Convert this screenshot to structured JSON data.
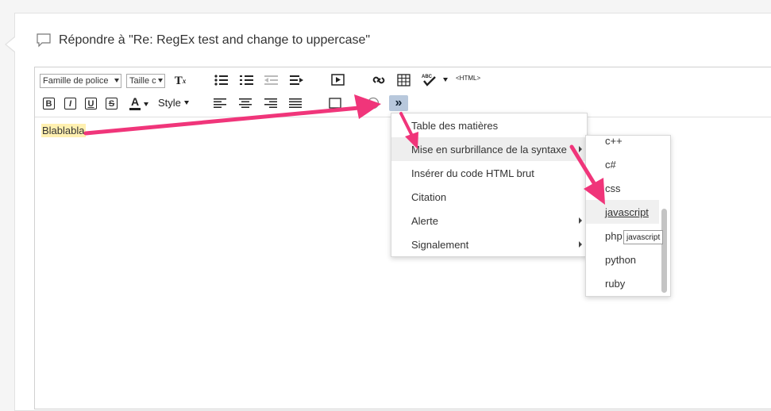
{
  "reply": {
    "title": "Répondre à \"Re: RegEx test and change to uppercase\""
  },
  "toolbar": {
    "font_family": "Famille de police",
    "font_size": "Taille c",
    "clear_format": "T",
    "clear_format_sub": "x",
    "html_label": "<HTML>",
    "spell_label": "ABC",
    "bold": "B",
    "italic": "I",
    "underline": "U",
    "strike": "S",
    "text_color": "A",
    "style_label": "Style",
    "more_label": "»"
  },
  "editor": {
    "content": "Blablabla"
  },
  "menu": {
    "items": [
      {
        "label": "Table des matières",
        "submenu": false
      },
      {
        "label": "Mise en surbrillance de la syntaxe",
        "submenu": true
      },
      {
        "label": "Insérer du code HTML brut",
        "submenu": false
      },
      {
        "label": "Citation",
        "submenu": false
      },
      {
        "label": "Alerte",
        "submenu": true
      },
      {
        "label": "Signalement",
        "submenu": true
      }
    ]
  },
  "submenu": {
    "items": [
      "c++",
      "c#",
      "css",
      "javascript",
      "php",
      "python",
      "ruby"
    ],
    "selected": "javascript"
  },
  "tooltip": "javascript",
  "colors": {
    "arrow": "#f0357a",
    "highlight": "#fff0b0",
    "more_button": "#b8c8dc"
  }
}
